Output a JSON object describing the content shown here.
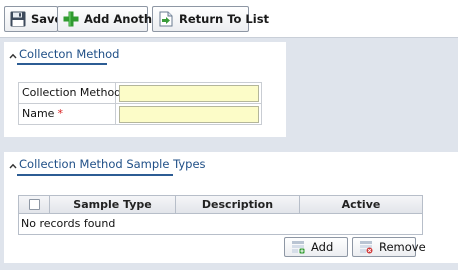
{
  "toolbar": {
    "save_label": "Save",
    "add_another_label": "Add Another",
    "return_label": "Return To List"
  },
  "section_method": {
    "title": "Collecton Method",
    "fields": [
      {
        "label": "Collection Method",
        "required_mark": "*",
        "value": ""
      },
      {
        "label": "Name",
        "required_mark": "*",
        "value": ""
      }
    ]
  },
  "section_sample_types": {
    "title": "Collection Method Sample Types",
    "columns": [
      "Sample Type",
      "Description",
      "Active"
    ],
    "empty_message": "No records found",
    "add_label": "Add",
    "remove_label": "Remove"
  },
  "colors": {
    "accent": "#1f4f87",
    "required": "#d81e1e",
    "input_bg": "#fcfcc8",
    "page_bg": "#dfe4ec"
  },
  "icons": {
    "save": "floppy-disk-icon",
    "add_another": "green-plus-icon",
    "return": "document-arrow-icon",
    "collapse": "chevron-up-icon",
    "add": "add-row-icon",
    "remove": "remove-row-icon"
  }
}
